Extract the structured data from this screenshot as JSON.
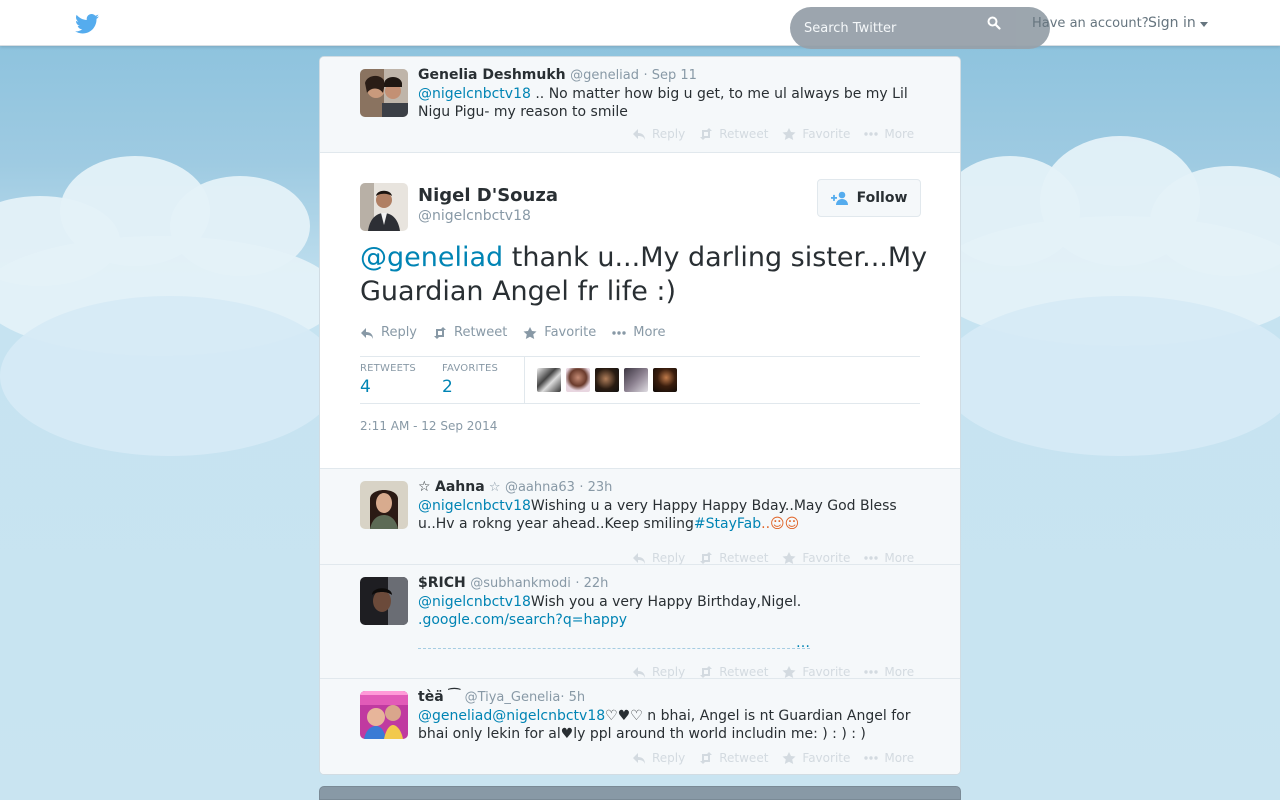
{
  "header": {
    "search_placeholder": "Search Twitter",
    "account_prompt": "Have an account?",
    "signin_label": "Sign in"
  },
  "action_labels": {
    "reply": "Reply",
    "retweet": "Retweet",
    "favorite": "Favorite",
    "more": "More"
  },
  "context_tweet": {
    "name": "Genelia Deshmukh",
    "handle": "@geneliad",
    "time": "· Sep 11",
    "mention": "@nigelcnbctv18",
    "text_line": " .. No matter how big u get, to me ul always be my Lil Nigu Pigu- my reason to smile"
  },
  "main_tweet": {
    "name": "Nigel D'Souza",
    "handle": "@nigelcnbctv18",
    "follow_label": "Follow",
    "mention": "@geneliad",
    "text": " thank u...My darling sister...My Guardian Angel fr life :)",
    "retweets_label": "RETWEETS",
    "retweets": "4",
    "favorites_label": "FAVORITES",
    "favorites": "2",
    "timestamp": "2:11 AM - 12 Sep 2014"
  },
  "replies": [
    {
      "prefix": "☆ ",
      "name": "Aahna",
      "suffix": " ☆",
      "handle": "@aahna63",
      "time": "· 23h",
      "mention": "@nigelcnbctv18",
      "text": "Wishing u a very Happy Happy Bday..May God Bless u..Hv a rokng year ahead..Keep smiling",
      "hashtag": "#StayFab",
      "tail": "..☺☺"
    },
    {
      "name": "$RICH",
      "handle": "@subhankmodi",
      "time": "· 22h",
      "mention": "@nigelcnbctv18",
      "text": "Wish you a very Happy Birthday,Nigel.",
      "link": ".google.com/search?q=happy",
      "link2": "…"
    },
    {
      "name": "tèä ⁀",
      "handle": "@Tiya_Genelia",
      "time": "· 5h",
      "mention1": "@geneliad",
      "mention2": "@nigelcnbctv18",
      "text": "♡♥♡ n bhai, Angel is nt Guardian Angel for bhai only lekin for al♥ly ppl around th world includin me: ) : ) : )"
    }
  ]
}
